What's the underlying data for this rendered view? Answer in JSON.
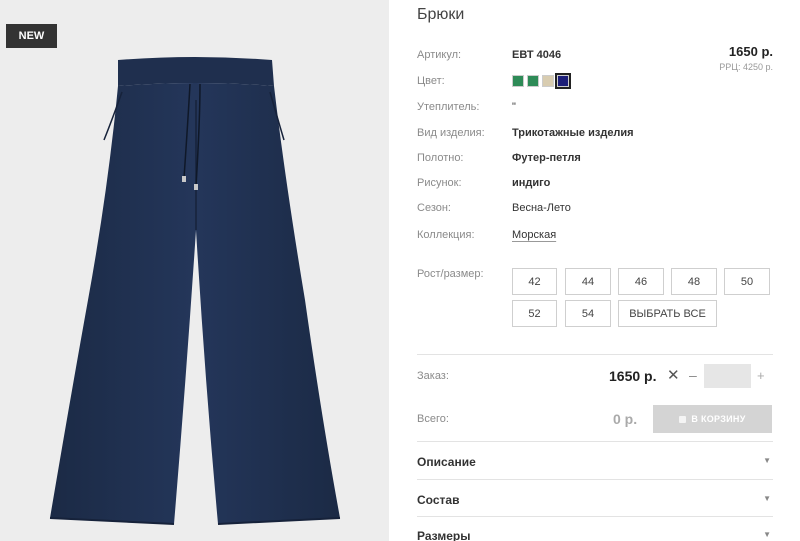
{
  "product": {
    "badge": "NEW",
    "title": "Брюки",
    "price": "1650 р.",
    "rrc": "РРЦ: 4250 р."
  },
  "attributes": [
    {
      "label": "Артикул:",
      "value": "ЕВТ 4046"
    },
    {
      "label": "Цвет:",
      "value": ""
    },
    {
      "label": "Утеплитель:",
      "value": "\""
    },
    {
      "label": "Вид изделия:",
      "value": "Трикотажные изделия"
    },
    {
      "label": "Полотно:",
      "value": "Футер-петля"
    },
    {
      "label": "Рисунок:",
      "value": "индиго"
    },
    {
      "label": "Сезон:",
      "value": "Весна-Лето"
    },
    {
      "label": "Коллекция:",
      "value": "Морская"
    }
  ],
  "colors": [
    {
      "hex": "#2e8b57",
      "selected": false
    },
    {
      "hex": "#2e8b57",
      "selected": false
    },
    {
      "hex": "#d8ccb0",
      "selected": false
    },
    {
      "hex": "#1c1e78",
      "selected": true
    }
  ],
  "sizes": {
    "label": "Рост/размер:",
    "options": [
      "42",
      "44",
      "46",
      "48",
      "50",
      "52",
      "54"
    ],
    "select_all": "ВЫБРАТЬ ВСЕ"
  },
  "order": {
    "label": "Заказ:",
    "price": "1650 р.",
    "times": "✕",
    "minus": "–",
    "plus": "+",
    "quantity": ""
  },
  "total": {
    "label": "Всего:",
    "value": "0 р.",
    "cart_button": "В КОРЗИНУ"
  },
  "accordion": [
    {
      "label": "Описание",
      "chevron": "▼"
    },
    {
      "label": "Состав",
      "chevron": "▼"
    },
    {
      "label": "Размеры",
      "chevron": "▼"
    }
  ]
}
